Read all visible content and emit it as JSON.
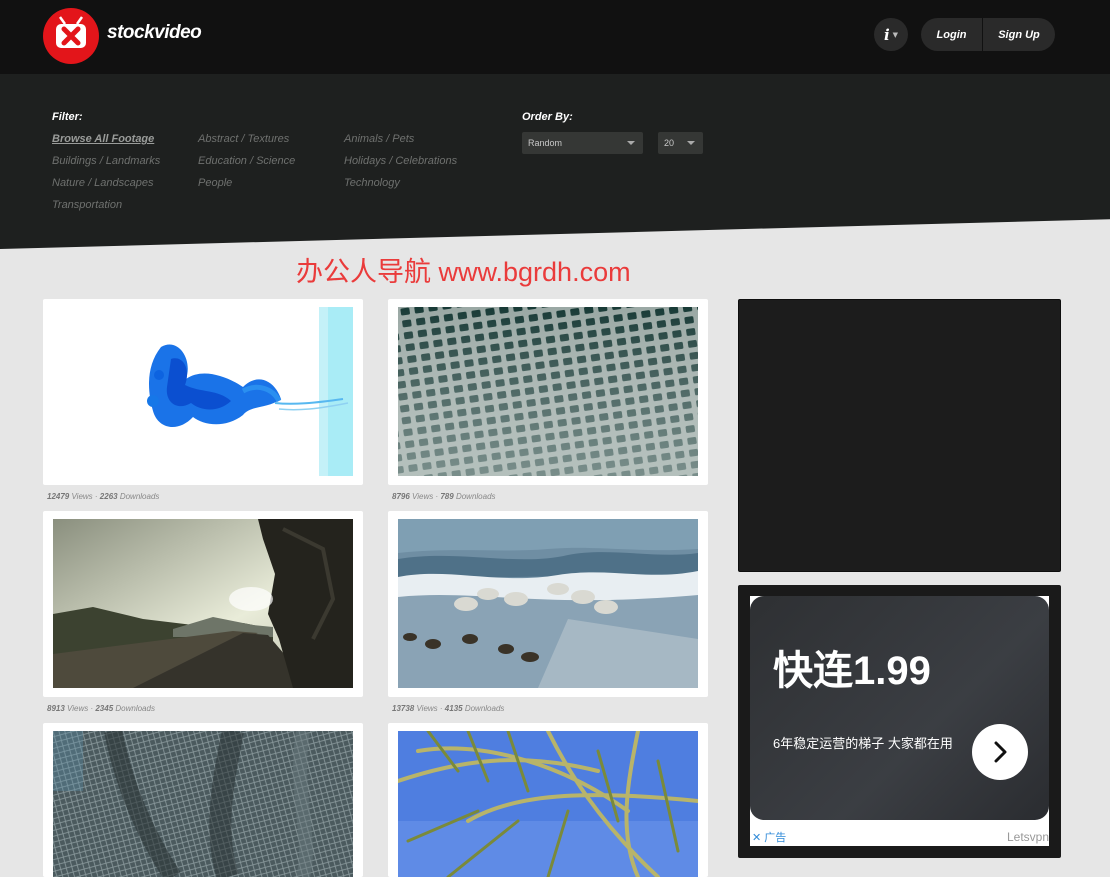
{
  "header": {
    "brand": "stockvideo",
    "info_icon": "i",
    "login": "Login",
    "signup": "Sign Up"
  },
  "filter": {
    "label": "Filter:",
    "categories": [
      "Browse All Footage",
      "Abstract / Textures",
      "Animals / Pets",
      "Buildings / Landmarks",
      "Education / Science",
      "Holidays / Celebrations",
      "Nature / Landscapes",
      "People",
      "Technology",
      "Transportation"
    ]
  },
  "order": {
    "label": "Order By:",
    "sort_value": "Random",
    "count_value": "20"
  },
  "watermark": "办公人导航  www.bgrdh.com",
  "videos": [
    {
      "views": "12479",
      "downloads": "2263"
    },
    {
      "views": "8796",
      "downloads": "789"
    },
    {
      "views": "8913",
      "downloads": "2345"
    },
    {
      "views": "13738",
      "downloads": "4135"
    },
    {
      "views": "",
      "downloads": ""
    },
    {
      "views": "",
      "downloads": ""
    }
  ],
  "labels": {
    "views": "Views",
    "downloads": "Downloads",
    "sep": " · "
  },
  "ad": {
    "title": "快连1.99",
    "subtitle": "6年稳定运营的梯子 大家都在用",
    "tag": "✕ 广告",
    "brand": "Letsvpn"
  },
  "colors": {
    "header_bg": "#111111",
    "panel_bg": "#1e201f",
    "logo_red": "#e3151a",
    "page_bg": "#e6e6e6",
    "watermark": "#ea3b3b"
  }
}
